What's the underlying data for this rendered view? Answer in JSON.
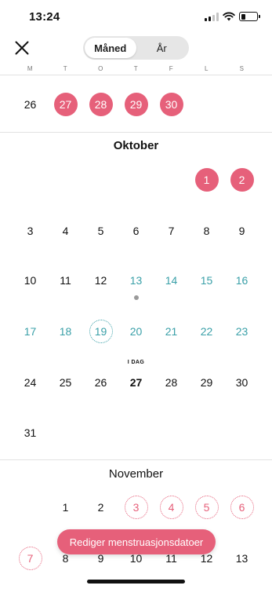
{
  "status": {
    "time": "13:24"
  },
  "segmented": {
    "month": "Måned",
    "year": "År"
  },
  "weekdays": [
    "M",
    "T",
    "O",
    "T",
    "F",
    "L",
    "S"
  ],
  "colors": {
    "period": "#e6607a",
    "fertile": "#3aa0a8",
    "ovulation_dot": "#9a9a9a"
  },
  "icons": {
    "close": "close-icon",
    "signal": "cellular-signal-icon",
    "wifi": "wifi-icon",
    "battery": "battery-icon"
  },
  "september": {
    "row": [
      {
        "d": "26"
      },
      {
        "d": "27",
        "s": "period"
      },
      {
        "d": "28",
        "s": "period"
      },
      {
        "d": "29",
        "s": "period"
      },
      {
        "d": "30",
        "s": "period"
      },
      null,
      null
    ]
  },
  "october": {
    "title": "Oktober",
    "today_label": "I DAG",
    "rows": [
      [
        null,
        null,
        null,
        null,
        null,
        {
          "d": "1",
          "s": "period"
        },
        {
          "d": "2",
          "s": "period"
        }
      ],
      [
        {
          "d": "3"
        },
        {
          "d": "4"
        },
        {
          "d": "5"
        },
        {
          "d": "6"
        },
        {
          "d": "7"
        },
        {
          "d": "8"
        },
        {
          "d": "9"
        }
      ],
      [
        {
          "d": "10"
        },
        {
          "d": "11"
        },
        {
          "d": "12"
        },
        {
          "d": "13",
          "s": "fertile",
          "dot": true
        },
        {
          "d": "14",
          "s": "fertile"
        },
        {
          "d": "15",
          "s": "fertile"
        },
        {
          "d": "16",
          "s": "fertile"
        }
      ],
      [
        {
          "d": "17",
          "s": "fertile"
        },
        {
          "d": "18",
          "s": "fertile"
        },
        {
          "d": "19",
          "s": "ovulation"
        },
        {
          "d": "20",
          "s": "fertile"
        },
        {
          "d": "21",
          "s": "fertile"
        },
        {
          "d": "22",
          "s": "fertile"
        },
        {
          "d": "23",
          "s": "fertile"
        }
      ],
      [
        {
          "d": "24"
        },
        {
          "d": "25"
        },
        {
          "d": "26"
        },
        {
          "d": "27",
          "s": "today"
        },
        {
          "d": "28"
        },
        {
          "d": "29"
        },
        {
          "d": "30"
        }
      ],
      [
        {
          "d": "31"
        },
        null,
        null,
        null,
        null,
        null,
        null
      ]
    ]
  },
  "november": {
    "title": "November",
    "rows": [
      [
        null,
        {
          "d": "1"
        },
        {
          "d": "2"
        },
        {
          "d": "3",
          "s": "predicted"
        },
        {
          "d": "4",
          "s": "predicted"
        },
        {
          "d": "5",
          "s": "predicted"
        },
        {
          "d": "6",
          "s": "predicted"
        }
      ],
      [
        {
          "d": "7",
          "s": "predicted"
        },
        {
          "d": "8"
        },
        {
          "d": "9"
        },
        {
          "d": "10"
        },
        {
          "d": "11"
        },
        {
          "d": "12"
        },
        {
          "d": "13"
        }
      ]
    ]
  },
  "edit_button": "Rediger menstruasjonsdatoer"
}
